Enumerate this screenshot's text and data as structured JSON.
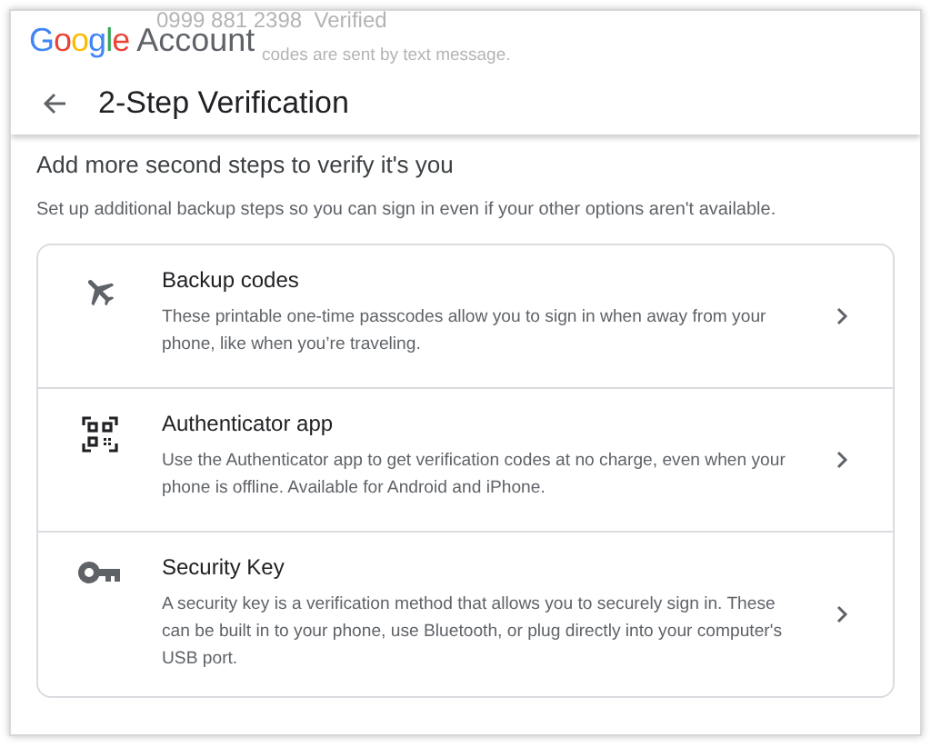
{
  "background": {
    "phone": "0999 881 2398",
    "status": "Verified",
    "note": "codes are sent by text message."
  },
  "header": {
    "brand_letters": [
      {
        "char": "G",
        "color": "#4285f4"
      },
      {
        "char": "o",
        "color": "#ea4335"
      },
      {
        "char": "o",
        "color": "#fbbc05"
      },
      {
        "char": "g",
        "color": "#4285f4"
      },
      {
        "char": "l",
        "color": "#34a853"
      },
      {
        "char": "e",
        "color": "#ea4335"
      }
    ],
    "product": "Account",
    "title": "2-Step Verification"
  },
  "heading": "Add more second steps to verify it's you",
  "subheading": "Set up additional backup steps so you can sign in even if your other options aren't available.",
  "options": [
    {
      "kind": "plane",
      "title": "Backup codes",
      "description": "These printable one-time passcodes allow you to sign in when away from your phone, like when you’re traveling."
    },
    {
      "kind": "qr",
      "title": "Authenticator app",
      "description": "Use the Authenticator app to get verification codes at no charge, even when your phone is offline. Available for Android and iPhone."
    },
    {
      "kind": "key",
      "title": "Security Key",
      "description": "A security key is a verification method that allows you to securely sign in. These can be built in to your phone, use Bluetooth, or plug directly into your computer's USB port."
    }
  ]
}
